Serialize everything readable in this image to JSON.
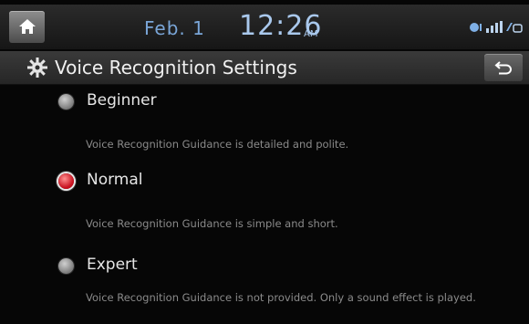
{
  "status": {
    "date": "Feb. 1",
    "time": "12:26",
    "ampm": "AM",
    "icons": [
      "bluetooth-audio-icon",
      "signal-bars-icon",
      "connectivity-icon"
    ]
  },
  "header": {
    "title": "Voice Recognition Settings",
    "title_icon": "gear-icon",
    "back_icon": "back-arrow-icon"
  },
  "options": [
    {
      "label": "Beginner",
      "description": "Voice Recognition Guidance is detailed and polite.",
      "selected": false
    },
    {
      "label": "Normal",
      "description": "Voice Recognition Guidance is simple and short.",
      "selected": true
    },
    {
      "label": "Expert",
      "description": "Voice Recognition Guidance is not provided. Only a sound effect is played.",
      "selected": false
    }
  ],
  "colors": {
    "selected_radio": "#c8101e",
    "clock_text": "#a9c8ec"
  }
}
